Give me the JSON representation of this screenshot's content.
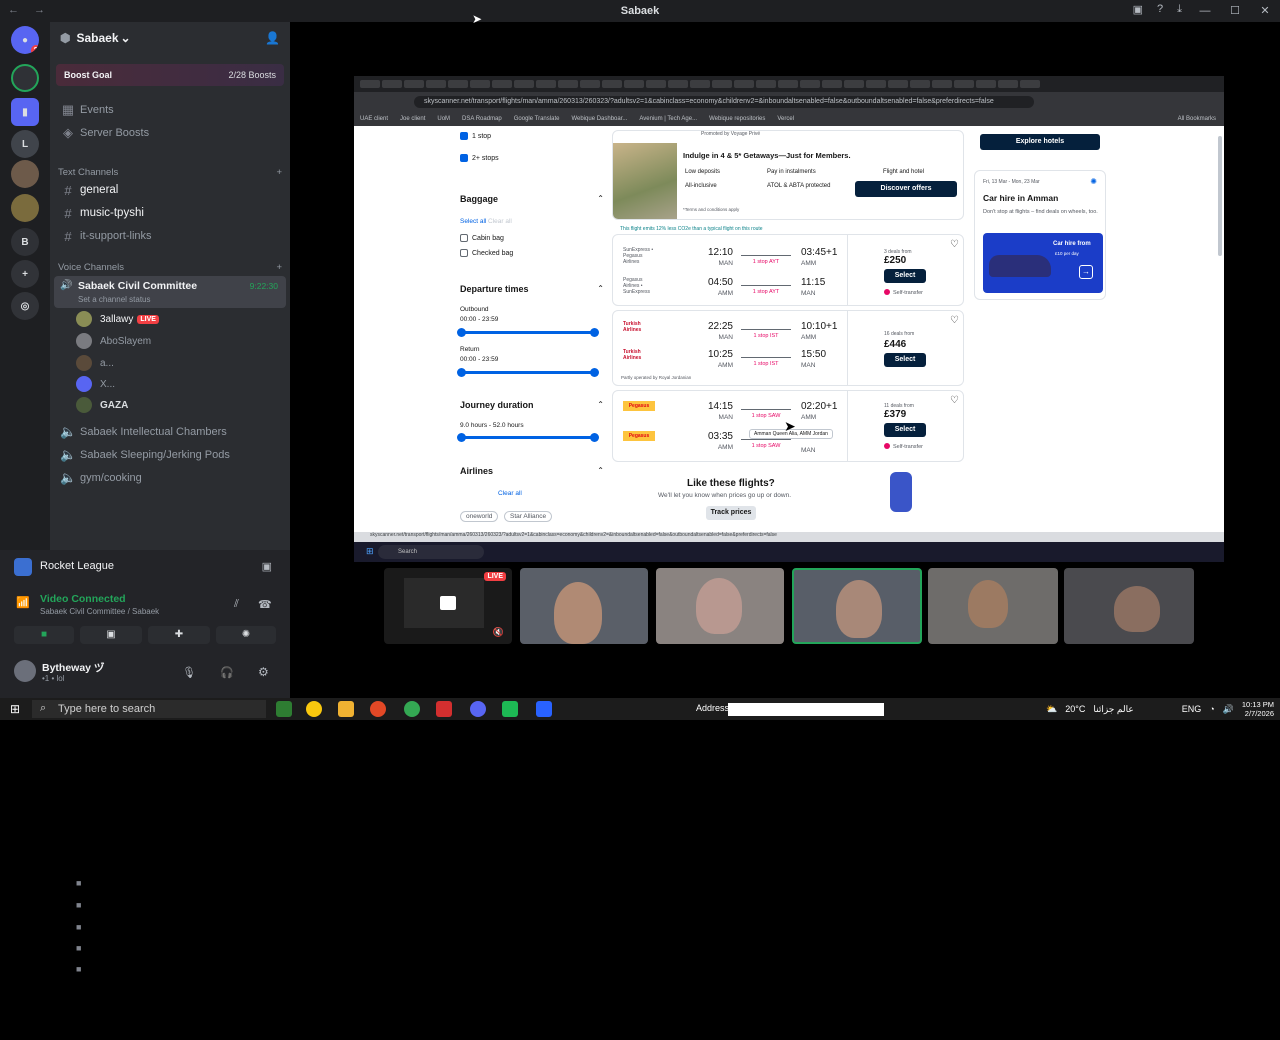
{
  "titlebar": {
    "title": "Sabaek"
  },
  "sidebar": {
    "server_name": "Sabaek",
    "boost_goal": "Boost Goal",
    "boost_count": "2/28 Boosts",
    "events": "Events",
    "server_boosts": "Server Boosts",
    "text_channels_header": "Text Channels",
    "text_channels": [
      "general",
      "music-tpyshi",
      "it-support-links"
    ],
    "voice_channels_header": "Voice Channels",
    "active_vc": "Sabaek Civil Committee",
    "active_vc_time": "9:22:30",
    "active_vc_status": "Set a channel status",
    "members": [
      "3allawy",
      "AboSlayem",
      "a...",
      "X...",
      "GAZA"
    ],
    "live_label": "LIVE",
    "voice_channels": [
      "Sabaek Intellectual Chambers",
      "Sabaek Sleeping/Jerking Pods",
      "gym/cooking"
    ],
    "activity": "Rocket League",
    "voice_connected": "Video Connected",
    "voice_location": "Sabaek Civil Committee / Sabaek",
    "username": "Bytheway ヅ",
    "user_status": "•1 • lol",
    "rail_badge": "2"
  },
  "stream": {
    "url": "skyscanner.net/transport/flights/man/amma/260313/260323/?adultsv2=1&cabinclass=economy&childrenv2=&inboundaltsenabled=false&outboundaltsenabled=false&preferdirects=false",
    "bookmarks": [
      "UAE client",
      "Joe client",
      "UoM",
      "DSA Roadmap",
      "Google Translate",
      "Webique Dashboar...",
      "Avenium | Tech Age...",
      "Webique repositories",
      "Vercel",
      "All Bookmarks"
    ],
    "filters": {
      "stops": [
        "1 stop",
        "2+ stops"
      ],
      "baggage_title": "Baggage",
      "select_all": "Select all",
      "clear_all": "Clear all",
      "baggage": [
        "Cabin bag",
        "Checked bag"
      ],
      "departure_title": "Departure times",
      "outbound": "Outbound",
      "outbound_range": "00:00 - 23:59",
      "return": "Return",
      "return_range": "00:00 - 23:59",
      "journey_title": "Journey duration",
      "journey_range": "9.0 hours - 52.0 hours",
      "airlines_title": "Airlines",
      "alliances": [
        "oneworld",
        "Star Alliance"
      ]
    },
    "promo": {
      "tag": "Promoted by Voyage Privé",
      "title": "Indulge in 4 & 5* Getaways—Just for Members.",
      "features": [
        "Low deposits",
        "Pay in instalments",
        "All-inclusive",
        "ATOL & ABTA protected"
      ],
      "flight_hotel": "Flight and hotel",
      "cta": "Discover offers",
      "terms": "*Terms and conditions apply"
    },
    "co2_note": "This flight emits 12% less CO2e than a typical flight on this route",
    "results": [
      {
        "airline1": "SunExpress • Pegasus Airlines",
        "dep1": "12:10",
        "dc1": "MAN",
        "stop1": "1 stop AYT",
        "arr1": "03:45+1",
        "ac1": "AMM",
        "airline2": "Pegasus Airlines • SunExpress",
        "dep2": "04:50",
        "dc2": "AMM",
        "stop2": "1 stop AYT",
        "arr2": "11:15",
        "ac2": "MAN",
        "deals": "3 deals from",
        "price": "£250",
        "select": "Select",
        "extra": "Self-transfer"
      },
      {
        "airline1": "Turkish Airlines",
        "dep1": "22:25",
        "dc1": "MAN",
        "stop1": "1 stop IST",
        "arr1": "10:10+1",
        "ac1": "AMM",
        "airline2": "Turkish Airlines",
        "dep2": "10:25",
        "dc2": "AMM",
        "stop2": "1 stop IST",
        "arr2": "15:50",
        "ac2": "MAN",
        "deals": "16 deals from",
        "price": "£446",
        "select": "Select",
        "extra": "Partly operated by Royal Jordanian"
      },
      {
        "airline1": "Pegasus",
        "dep1": "14:15",
        "dc1": "MAN",
        "stop1": "1 stop SAW",
        "arr1": "02:20+1",
        "ac1": "AMM",
        "airline2": "Pegasus",
        "dep2": "03:35",
        "dc2": "AMM",
        "stop2": "1 stop SAW",
        "arr2": "",
        "ac2": "MAN",
        "deals": "11 deals from",
        "price": "£379",
        "select": "Select",
        "extra": "Self-transfer"
      }
    ],
    "tooltip": "Amman Queen Alia, AMM Jordan",
    "like_title": "Like these flights?",
    "like_sub": "We'll let you know when prices go up or down.",
    "track": "Track prices",
    "explore_hotels": "Explore hotels",
    "car_dates": "Fri, 13 Mar - Mon, 23 Mar",
    "car_title": "Car hire in Amman",
    "car_sub": "Don't stop at flights – find deals on wheels, too.",
    "car_banner": "Car hire from",
    "car_banner_sub": "£10 per day"
  },
  "inner_taskbar": {
    "search": "Search"
  },
  "taskbar": {
    "search_placeholder": "Type here to search",
    "address_label": "Address",
    "weather": "20°C",
    "weather_ar": "عالم جزائنا",
    "lang": "ENG",
    "time": "10:13 PM",
    "date": "2/7/2026"
  },
  "colors": {
    "discord_green": "#23a55a",
    "live_red": "#f23f43",
    "sky_navy": "#05203c",
    "sky_blue": "#0062e3"
  }
}
